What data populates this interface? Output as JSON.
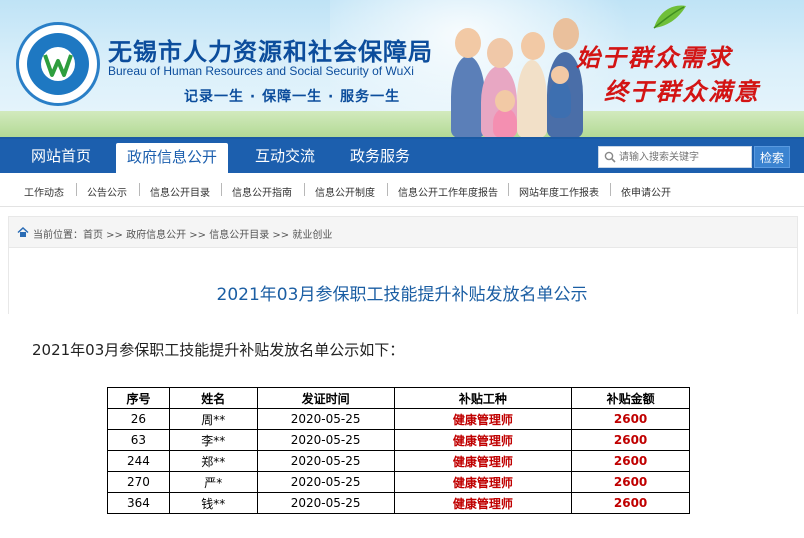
{
  "header": {
    "site_title": "无锡市人力资源和社会保障局",
    "site_subtitle": "Bureau of Human Resources and Social Security of WuXi",
    "slogan": "记录一生 · 保障一生 · 服务一生",
    "red_slogan_line1": "始于群众需求",
    "red_slogan_line2": "终于群众满意",
    "colors": {
      "primary": "#1c5fae",
      "accent_red": "#d31414",
      "table_red": "#c00000"
    }
  },
  "nav": {
    "items": [
      {
        "label": "网站首页"
      },
      {
        "label": "政府信息公开",
        "active": true
      },
      {
        "label": "互动交流"
      },
      {
        "label": "政务服务"
      }
    ],
    "search": {
      "placeholder": "请输入搜索关键字",
      "button": "检索",
      "icon": "search-icon"
    }
  },
  "subnav": {
    "items": [
      {
        "label": "工作动态"
      },
      {
        "label": "公告公示"
      },
      {
        "label": "信息公开目录"
      },
      {
        "label": "信息公开指南"
      },
      {
        "label": "信息公开制度"
      },
      {
        "label": "信息公开工作年度报告"
      },
      {
        "label": "网站年度工作报表"
      },
      {
        "label": "依申请公开"
      }
    ]
  },
  "breadcrumb": {
    "text": "当前位置：首页 >> 政府信息公开 >> 信息公开目录 >> 就业创业",
    "icon": "home-icon"
  },
  "article": {
    "title": "2021年03月参保职工技能提升补贴发放名单公示",
    "intro": "2021年03月参保职工技能提升补贴发放名单公示如下："
  },
  "table": {
    "headers": [
      "序号",
      "姓名",
      "发证时间",
      "补贴工种",
      "补贴金额"
    ],
    "rows": [
      [
        "26",
        "周**",
        "2020-05-25",
        "健康管理师",
        "2600"
      ],
      [
        "63",
        "李**",
        "2020-05-25",
        "健康管理师",
        "2600"
      ],
      [
        "244",
        "郑**",
        "2020-05-25",
        "健康管理师",
        "2600"
      ],
      [
        "270",
        "严*",
        "2020-05-25",
        "健康管理师",
        "2600"
      ],
      [
        "364",
        "钱**",
        "2020-05-25",
        "健康管理师",
        "2600"
      ]
    ]
  }
}
